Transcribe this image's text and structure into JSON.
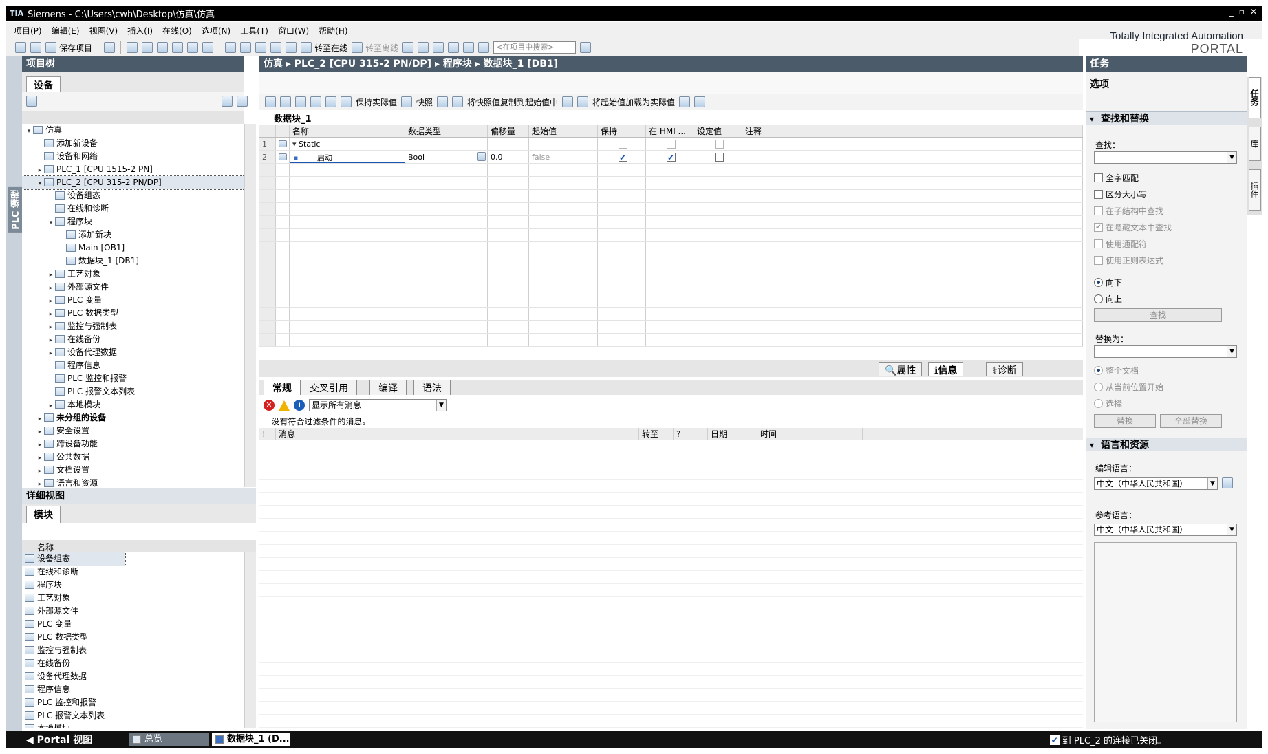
{
  "window": {
    "logo": "TIA",
    "title": "Siemens  -  C:\\Users\\cwh\\Desktop\\仿真\\仿真",
    "controls": [
      "_",
      "▫",
      "✕"
    ]
  },
  "menu": [
    "项目(P)",
    "编辑(E)",
    "视图(V)",
    "插入(I)",
    "在线(O)",
    "选项(N)",
    "工具(T)",
    "窗口(W)",
    "帮助(H)"
  ],
  "brand": {
    "line1": "Totally Integrated Automation",
    "line2": "PORTAL"
  },
  "toolbar": {
    "save_project": "保存项目",
    "go_online": "转至在线",
    "go_offline": "转至离线",
    "search_placeholder": "<在项目中搜索>"
  },
  "left_vertical_tab": "PLC 编程",
  "project_tree": {
    "title": "项目树",
    "tab": "设备",
    "items": [
      {
        "arrow": "▾",
        "indent": 0,
        "label": "仿真"
      },
      {
        "arrow": "",
        "indent": 1,
        "label": "添加新设备"
      },
      {
        "arrow": "",
        "indent": 1,
        "label": "设备和网络"
      },
      {
        "arrow": "▸",
        "indent": 1,
        "label": "PLC_1 [CPU 1515-2 PN]"
      },
      {
        "arrow": "▾",
        "indent": 1,
        "label": "PLC_2 [CPU 315-2 PN/DP]",
        "selected": true
      },
      {
        "arrow": "",
        "indent": 2,
        "label": "设备组态"
      },
      {
        "arrow": "",
        "indent": 2,
        "label": "在线和诊断"
      },
      {
        "arrow": "▾",
        "indent": 2,
        "label": "程序块"
      },
      {
        "arrow": "",
        "indent": 3,
        "label": "添加新块"
      },
      {
        "arrow": "",
        "indent": 3,
        "label": "Main [OB1]"
      },
      {
        "arrow": "",
        "indent": 3,
        "label": "数据块_1 [DB1]"
      },
      {
        "arrow": "▸",
        "indent": 2,
        "label": "工艺对象"
      },
      {
        "arrow": "▸",
        "indent": 2,
        "label": "外部源文件"
      },
      {
        "arrow": "▸",
        "indent": 2,
        "label": "PLC 变量"
      },
      {
        "arrow": "▸",
        "indent": 2,
        "label": "PLC 数据类型"
      },
      {
        "arrow": "▸",
        "indent": 2,
        "label": "监控与强制表"
      },
      {
        "arrow": "▸",
        "indent": 2,
        "label": "在线备份"
      },
      {
        "arrow": "▸",
        "indent": 2,
        "label": "设备代理数据"
      },
      {
        "arrow": "",
        "indent": 2,
        "label": "程序信息"
      },
      {
        "arrow": "",
        "indent": 2,
        "label": "PLC 监控和报警"
      },
      {
        "arrow": "",
        "indent": 2,
        "label": "PLC 报警文本列表"
      },
      {
        "arrow": "▸",
        "indent": 2,
        "label": "本地模块"
      },
      {
        "arrow": "▸",
        "indent": 1,
        "label": "未分组的设备",
        "bold": true
      },
      {
        "arrow": "▸",
        "indent": 1,
        "label": "安全设置"
      },
      {
        "arrow": "▸",
        "indent": 1,
        "label": "跨设备功能"
      },
      {
        "arrow": "▸",
        "indent": 1,
        "label": "公共数据"
      },
      {
        "arrow": "▸",
        "indent": 1,
        "label": "文档设置"
      },
      {
        "arrow": "▸",
        "indent": 1,
        "label": "语言和资源"
      }
    ]
  },
  "detail_view": {
    "title": "详细视图",
    "tab": "模块",
    "col_name": "名称",
    "items": [
      "设备组态",
      "在线和诊断",
      "程序块",
      "工艺对象",
      "外部源文件",
      "PLC 变量",
      "PLC 数据类型",
      "监控与强制表",
      "在线备份",
      "设备代理数据",
      "程序信息",
      "PLC 监控和报警",
      "PLC 报警文本列表",
      "本地模块"
    ]
  },
  "editor": {
    "breadcrumb": [
      "仿真",
      "PLC_2 [CPU 315-2 PN/DP]",
      "程序块",
      "数据块_1 [DB1]"
    ],
    "toolbar": {
      "keep_actual": "保持实际值",
      "snapshot": "快照",
      "copy_snapshot": "将快照值复制到起始值中",
      "load_start": "将起始值加载为实际值"
    },
    "db_name": "数据块_1",
    "columns": [
      "名称",
      "数据类型",
      "偏移量",
      "起始值",
      "保持",
      "在 HMI ...",
      "设定值",
      "注释"
    ],
    "rows": [
      {
        "num": "1",
        "name": "Static",
        "type": "",
        "offset": "",
        "start": "",
        "retain": false,
        "hmi": false,
        "setpoint": false
      },
      {
        "num": "2",
        "name": "启动",
        "type": "Bool",
        "offset": "0.0",
        "start": "false",
        "retain": true,
        "hmi": true,
        "setpoint": false
      }
    ]
  },
  "inspector": {
    "tabs": [
      "属性",
      "信息",
      "诊断"
    ],
    "subtabs": [
      "常规",
      "交叉引用",
      "编译",
      "语法"
    ],
    "filter": "显示所有消息",
    "no_match": "-没有符合过滤条件的消息。",
    "columns": [
      "!",
      "消息",
      "转至",
      "?",
      "日期",
      "时间"
    ]
  },
  "tasks": {
    "title": "任务",
    "options": "选项",
    "find_replace": {
      "title": "查找和替换",
      "find_label": "查找：",
      "checks": [
        {
          "label": "全字匹配",
          "enabled": true
        },
        {
          "label": "区分大小写",
          "enabled": true
        },
        {
          "label": "在子结构中查找",
          "enabled": false
        },
        {
          "label": "在隐藏文本中查找",
          "enabled": false,
          "checked": true
        },
        {
          "label": "使用通配符",
          "enabled": false
        },
        {
          "label": "使用正则表达式",
          "enabled": false
        }
      ],
      "down": "向下",
      "up": "向上",
      "find_btn": "查找",
      "replace_label": "替换为：",
      "scope": [
        "整个文档",
        "从当前位置开始",
        "选择"
      ],
      "replace_btn": "替换",
      "replace_all_btn": "全部替换"
    },
    "lang": {
      "title": "语言和资源",
      "edit_label": "编辑语言：",
      "edit_value": "中文（中华人民共和国）",
      "ref_label": "参考语言：",
      "ref_value": "中文（中华人民共和国）"
    },
    "vtabs": [
      "任务",
      "库",
      "插件"
    ]
  },
  "statusbar": {
    "portal": "Portal 视图",
    "tab_overview": "总览",
    "tab_db": "数据块_1 (D...",
    "connection": "到 PLC_2 的连接已关闭。"
  }
}
